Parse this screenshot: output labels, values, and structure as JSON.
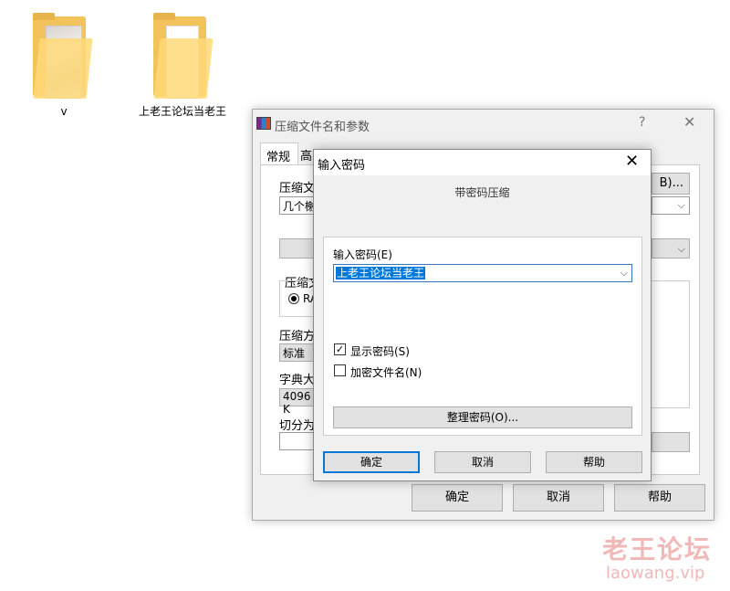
{
  "desktop": {
    "icons": [
      {
        "label": "v"
      },
      {
        "label": "上老王论坛当老王"
      }
    ]
  },
  "main_dialog": {
    "title": "压缩文件名和参数",
    "help_glyph": "?",
    "close_glyph": "✕",
    "tabs": {
      "active": "常规",
      "partial": "高"
    },
    "archive_name_label_partial": "压缩文",
    "archive_name_value_partial": "几个榭",
    "browse_button_partial": "B)...",
    "format_group_label_partial": "压缩文",
    "format_radio_partial": "RA",
    "method_label_partial": "压缩方",
    "method_value_partial": "标准",
    "dict_label_partial": "字典大",
    "dict_value_partial": "4096 K",
    "split_label_partial": "切分为",
    "buttons": {
      "ok": "确定",
      "cancel": "取消",
      "help": "帮助"
    }
  },
  "password_dialog": {
    "title": "输入密码",
    "close_glyph": "✕",
    "heading": "带密码压缩",
    "password_label": "输入密码(E)",
    "password_value": "上老王论坛当老王",
    "show_password": {
      "label": "显示密码(S)",
      "checked": true
    },
    "encrypt_names": {
      "label": "加密文件名(N)",
      "checked": false
    },
    "organize_button": "整理密码(O)...",
    "buttons": {
      "ok": "确定",
      "cancel": "取消",
      "help": "帮助"
    }
  },
  "watermark": {
    "cn": "老王论坛",
    "en": "laowang.vip"
  }
}
